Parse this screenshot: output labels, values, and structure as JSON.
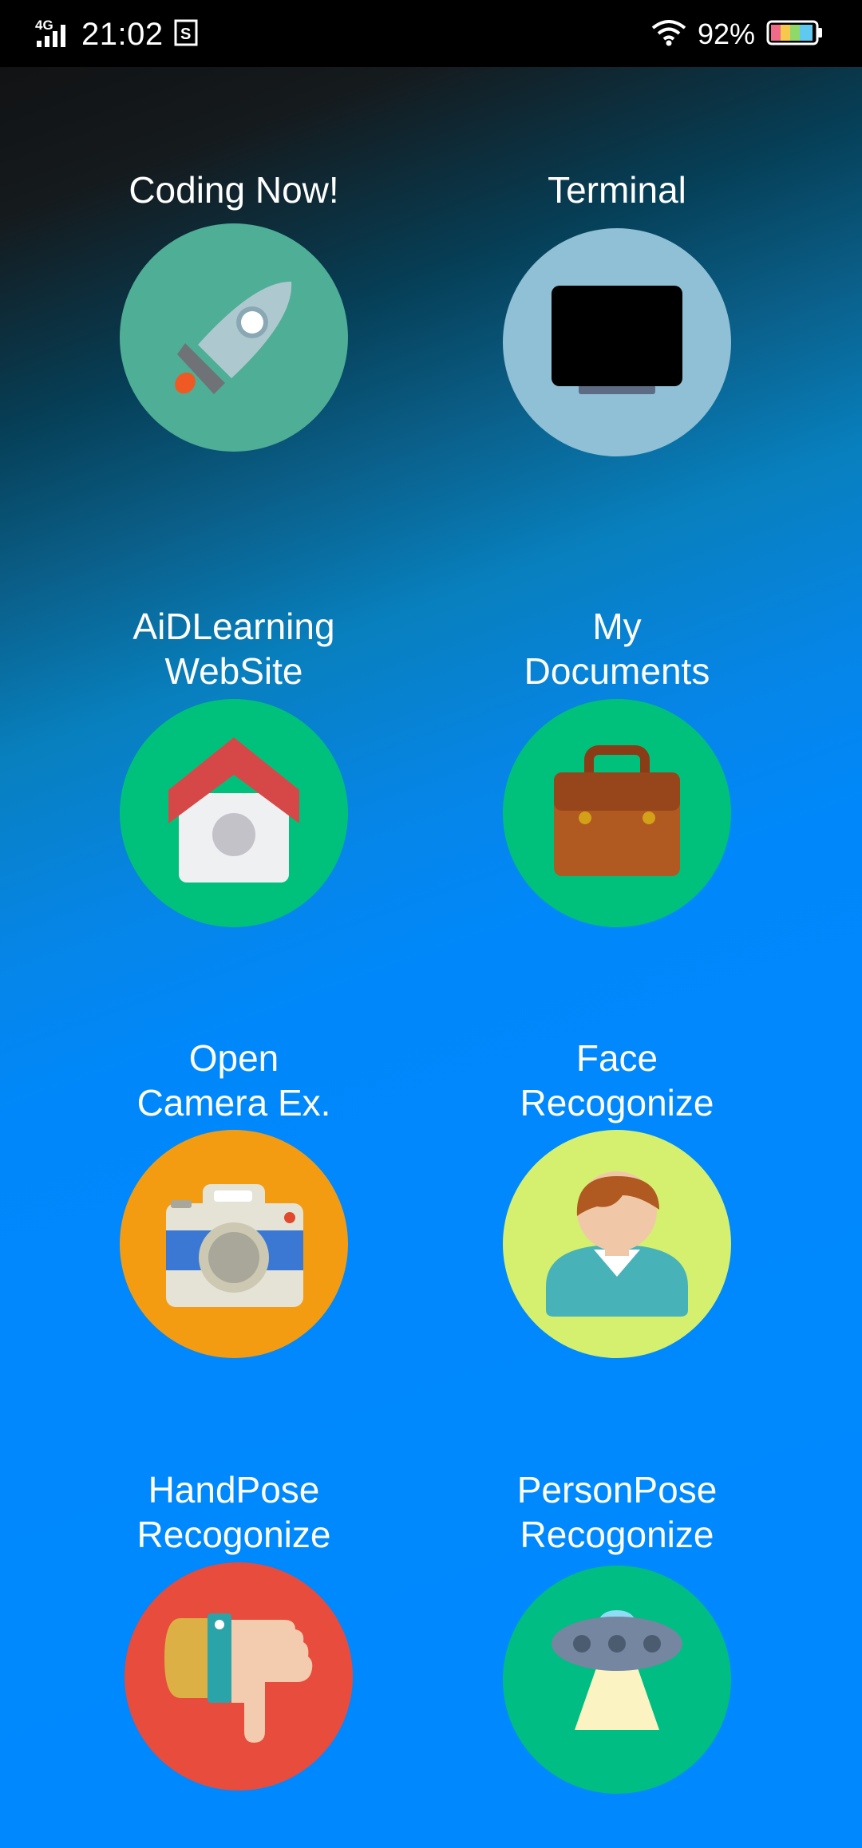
{
  "status_bar": {
    "network": "4G",
    "time": "21:02",
    "battery_percent": "92%"
  },
  "apps": [
    {
      "label_lines": [
        "Coding Now!"
      ],
      "icon": "rocket-icon",
      "bg_color": "#4fae96"
    },
    {
      "label_lines": [
        "Terminal"
      ],
      "icon": "monitor-icon",
      "bg_color": "#8fc0d6"
    },
    {
      "label_lines": [
        "AiDLearning",
        "WebSite"
      ],
      "icon": "house-icon",
      "bg_color": "#00c17c"
    },
    {
      "label_lines": [
        "My",
        "Documents"
      ],
      "icon": "briefcase-icon",
      "bg_color": "#00c17c"
    },
    {
      "label_lines": [
        "Open",
        "Camera Ex."
      ],
      "icon": "camera-icon",
      "bg_color": "#f39c12"
    },
    {
      "label_lines": [
        "Face",
        "Recogonize"
      ],
      "icon": "person-icon",
      "bg_color": "#d4f06e"
    },
    {
      "label_lines": [
        "HandPose",
        "Recogonize"
      ],
      "icon": "thumbs-down-icon",
      "bg_color": "#e74c3c"
    },
    {
      "label_lines": [
        "PersonPose",
        "Recogonize"
      ],
      "icon": "ufo-icon",
      "bg_color": "#00bd84"
    }
  ]
}
